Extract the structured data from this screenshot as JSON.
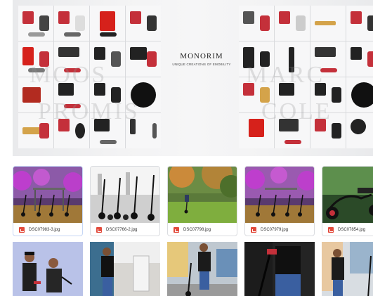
{
  "banner": {
    "brand_name": "MONORIM",
    "brand_tagline": "UNIQUE CREATIONS OF EMOBILITY",
    "watermarks": [
      "MOOS",
      "PROMIS",
      "MARC",
      "COLE"
    ]
  },
  "gallery": {
    "row1": [
      {
        "filename": "DSC07983-3.jpg",
        "selected": true
      },
      {
        "filename": "DSC07766-2.jpg",
        "selected": false
      },
      {
        "filename": "DSC07798.jpg",
        "selected": false
      },
      {
        "filename": "DSC07979.jpg",
        "selected": false
      },
      {
        "filename": "DSC07854.jpg",
        "selected": false
      }
    ],
    "row2_count": 5
  },
  "colors": {
    "jpg_icon": "#e24b3c",
    "selected_border": "#c6d7f5",
    "magenta_light": "#c23bd0"
  },
  "icons": {
    "file": "jpg-file-icon"
  }
}
